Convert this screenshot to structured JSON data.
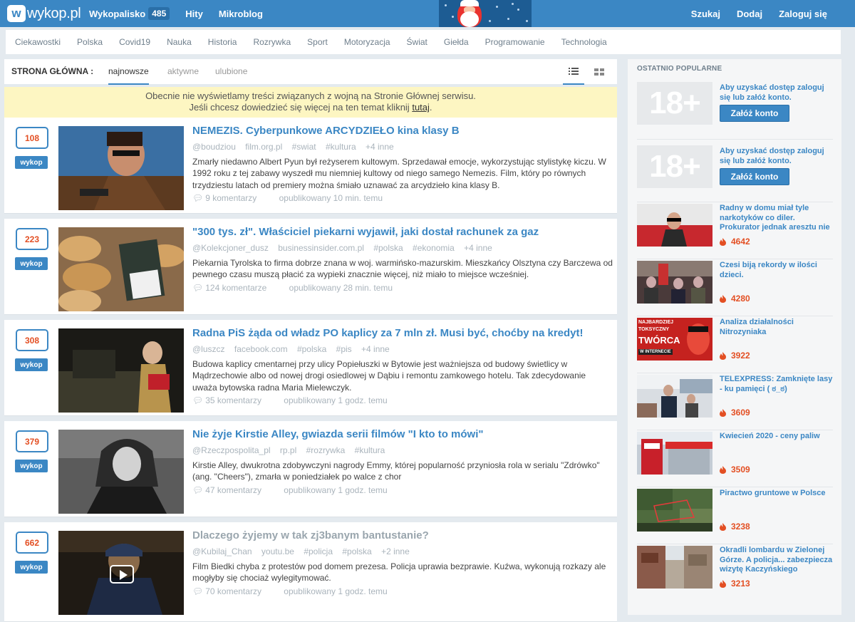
{
  "topbar": {
    "logo_text": "wykop.pl",
    "nav": [
      {
        "label": "Wykopalisko",
        "badge": "485"
      },
      {
        "label": "Hity"
      },
      {
        "label": "Mikroblog"
      }
    ],
    "right": [
      "Szukaj",
      "Dodaj",
      "Zaloguj się"
    ]
  },
  "categories": [
    "Ciekawostki",
    "Polska",
    "Covid19",
    "Nauka",
    "Historia",
    "Rozrywka",
    "Sport",
    "Motoryzacja",
    "Świat",
    "Giełda",
    "Programowanie",
    "Technologia"
  ],
  "tabs": {
    "label": "STRONA GŁÓWNA :",
    "items": [
      "najnowsze",
      "aktywne",
      "ulubione"
    ],
    "active": "najnowsze"
  },
  "notice": {
    "line1": "Obecnie nie wyświetlamy treści związanych z wojną na Stronie Głównej serwisu.",
    "line2": "Jeśli chcesz dowiedzieć się więcej na ten temat kliknij",
    "link": "tutaj",
    "end": "."
  },
  "vote_button_label": "wykop",
  "entries": [
    {
      "votes": "108",
      "title": "NEMEZIS. Cyberpunkowe ARCYDZIEŁO kina klasy B",
      "author": "@boudziou",
      "source": "film.org.pl",
      "tags": [
        "#swiat",
        "#kultura"
      ],
      "more": "+4 inne",
      "desc": "Zmarły niedawno Albert Pyun był reżyserem kultowym. Sprzedawał emocje, wykorzystując stylistykę kiczu. W 1992 roku z tej zabawy wyszedł mu niemniej kultowy od niego samego Nemezis. Film, który po równych trzydziestu latach od premiery można śmiało uznawać za arcydzieło kina klasy B.",
      "comments": "9 komentarzy",
      "published": "opublikowany 10 min. temu"
    },
    {
      "votes": "223",
      "title": "\"300 tys. zł\". Właściciel piekarni wyjawił, jaki dostał rachunek za gaz",
      "author": "@Kolekcjoner_dusz",
      "source": "businessinsider.com.pl",
      "tags": [
        "#polska",
        "#ekonomia"
      ],
      "more": "+4 inne",
      "desc": "Piekarnia Tyrolska to firma dobrze znana w woj. warmińsko-mazurskim. Mieszkańcy Olsztyna czy Barczewa od pewnego czasu muszą płacić za wypieki znacznie więcej, niż miało to miejsce wcześniej.",
      "comments": "124 komentarze",
      "published": "opublikowany 28 min. temu"
    },
    {
      "votes": "308",
      "title": "Radna PiS żąda od władz PO kaplicy za 7 mln zł. Musi być, choćby na kredyt!",
      "author": "@luszcz",
      "source": "facebook.com",
      "tags": [
        "#polska",
        "#pis"
      ],
      "more": "+4 inne",
      "desc": "Budowa kaplicy cmentarnej przy ulicy Popiełuszki w Bytowie jest ważniejsza od budowy świetlicy w Mądrzechowie albo od nowej drogi osiedlowej w Dąbiu i remontu zamkowego hotelu. Tak zdecydowanie uważa bytowska radna Maria Mielewczyk.",
      "comments": "35 komentarzy",
      "published": "opublikowany 1 godz. temu"
    },
    {
      "votes": "379",
      "title": "Nie żyje Kirstie Alley, gwiazda serii filmów \"I kto to mówi\"",
      "author": "@Rzeczpospolita_pl",
      "source": "rp.pl",
      "tags": [
        "#rozrywka",
        "#kultura"
      ],
      "more": "",
      "desc": "Kirstie Alley, dwukrotna zdobywczyni nagrody Emmy, której popularność przyniosła rola w serialu \"Zdrówko\" (ang. \"Cheers\"), zmarła w poniedziałek po walce z chor",
      "comments": "47 komentarzy",
      "published": "opublikowany 1 godz. temu"
    },
    {
      "votes": "662",
      "title": "Dlaczego żyjemy w tak zj3banym bantustanie?",
      "author": "@Kubilaj_Chan",
      "source": "youtu.be",
      "tags": [
        "#policja",
        "#polska"
      ],
      "more": "+2 inne",
      "desc": "Film Biedki chyba z protestów pod domem prezesa. Policja uprawia bezprawie. Kuźwa, wykonują rozkazy ale mogłyby się chociaż wylegitymować.",
      "comments": "70 komentarzy",
      "published": "opublikowany 1 godz. temu"
    }
  ],
  "sidebar": {
    "heading": "OSTATNIO POPULARNE",
    "adult_label": "18+",
    "adult_text": "Aby uzyskać dostęp zaloguj się lub załóż konto.",
    "adult_button": "Załóż konto",
    "items": [
      {
        "title": "Radny w domu miał tyle narkotyków co diler. Prokurator jednak aresztu nie",
        "votes": "4642"
      },
      {
        "title": "Czesi biją rekordy w ilości dzieci.",
        "votes": "4280"
      },
      {
        "title": "Analiza działalności Nitrozyniaka",
        "votes": "3922",
        "thumb_text": [
          "NAJBARDZIEJ",
          "TOKSYCZNY",
          "TWÓRCA",
          "W INTERNECIE"
        ]
      },
      {
        "title": "TELEXPRESS: Zamknięte lasy - ku pamięci ( ಠ_ಠ)",
        "votes": "3609"
      },
      {
        "title": "Kwiecień 2020 - ceny paliw",
        "votes": "3509"
      },
      {
        "title": "Piractwo gruntowe w Polsce",
        "votes": "3238"
      },
      {
        "title": "Okradli lombardu w Zielonej Górze. A policja... zabezpiecza wizytę Kaczyńskiego",
        "votes": "3213"
      }
    ]
  }
}
